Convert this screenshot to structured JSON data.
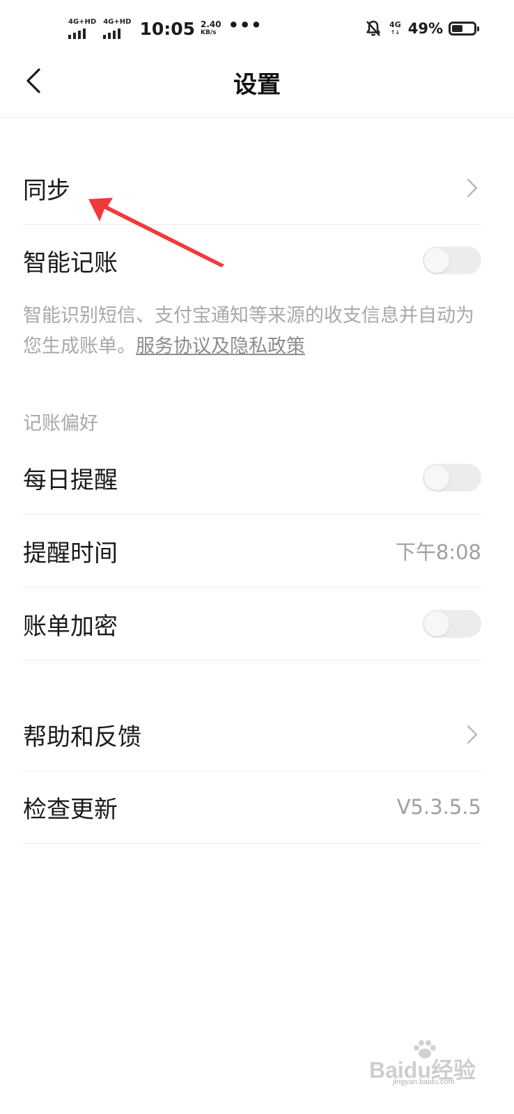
{
  "status_bar": {
    "signal1_label": "4G+HD",
    "signal2_label": "4G+HD",
    "time": "10:05",
    "speed_value": "2.40",
    "speed_unit": "KB/s",
    "more": "•••",
    "network_type": "4G",
    "network_arrows": "↑↓",
    "battery_percent": "49%",
    "battery_level": 0.49
  },
  "header": {
    "title": "设置",
    "back_icon": "chevron-left-icon"
  },
  "settings": {
    "sync": {
      "label": "同步",
      "icon": "chevron-right-icon"
    },
    "smart_bookkeeping": {
      "label": "智能记账",
      "enabled": false,
      "description": "智能识别短信、支付宝通知等来源的收支信息并自动为您生成账单。",
      "link_text": "服务协议及隐私政策"
    },
    "preferences_section_title": "记账偏好",
    "daily_reminder": {
      "label": "每日提醒",
      "enabled": false
    },
    "reminder_time": {
      "label": "提醒时间",
      "value": "下午8:08"
    },
    "bill_encryption": {
      "label": "账单加密",
      "enabled": false
    },
    "help_feedback": {
      "label": "帮助和反馈",
      "icon": "chevron-right-icon"
    },
    "check_update": {
      "label": "检查更新",
      "value": "V5.3.5.5"
    }
  },
  "annotation": {
    "arrow_color": "#f03a3a"
  },
  "watermark": {
    "text": "Baidu经验",
    "sub": "jingyan.baidu.com"
  },
  "colors": {
    "background": "#ffffff",
    "primary_text": "#1a1a1a",
    "secondary_text": "#a8a8a8",
    "toggle_off": "#ececec"
  }
}
